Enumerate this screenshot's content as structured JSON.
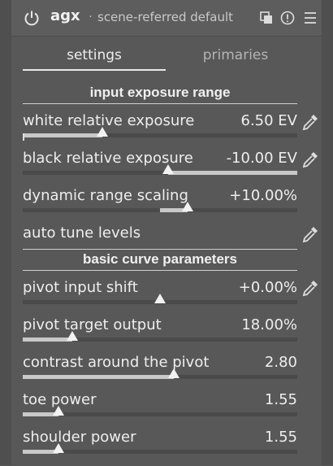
{
  "header": {
    "module_name": "agx",
    "separator": "·",
    "preset": "scene-referred default"
  },
  "tabs": [
    {
      "label": "settings",
      "active": true
    },
    {
      "label": "primaries",
      "active": false
    }
  ],
  "sections": {
    "input": "input exposure range",
    "curve": "basic curve parameters"
  },
  "params": {
    "white_exp": {
      "label": "white relative exposure",
      "value": "6.50 EV",
      "level": 0.29
    },
    "black_exp": {
      "label": "black relative exposure",
      "value": "-10.00 EV",
      "level": 0.53
    },
    "drs": {
      "label": "dynamic range scaling",
      "value": "+10.00%",
      "level": 0.6
    },
    "auto_tune": {
      "label": "auto tune levels"
    },
    "pivot_shift": {
      "label": "pivot input shift",
      "value": "+0.00%",
      "level": 0.5
    },
    "pivot_target": {
      "label": "pivot target output",
      "value": "18.00%",
      "level": 0.18
    },
    "contrast": {
      "label": "contrast around the pivot",
      "value": "2.80",
      "level": 0.55
    },
    "toe": {
      "label": "toe power",
      "value": "1.55",
      "level": 0.13
    },
    "shoulder": {
      "label": "shoulder power",
      "value": "1.55",
      "level": 0.13
    }
  },
  "colors": {
    "background": "#585858",
    "text": "#eeeeee",
    "slider_fill": "#c8c8c8",
    "slider_track": "#4a4a4a"
  }
}
